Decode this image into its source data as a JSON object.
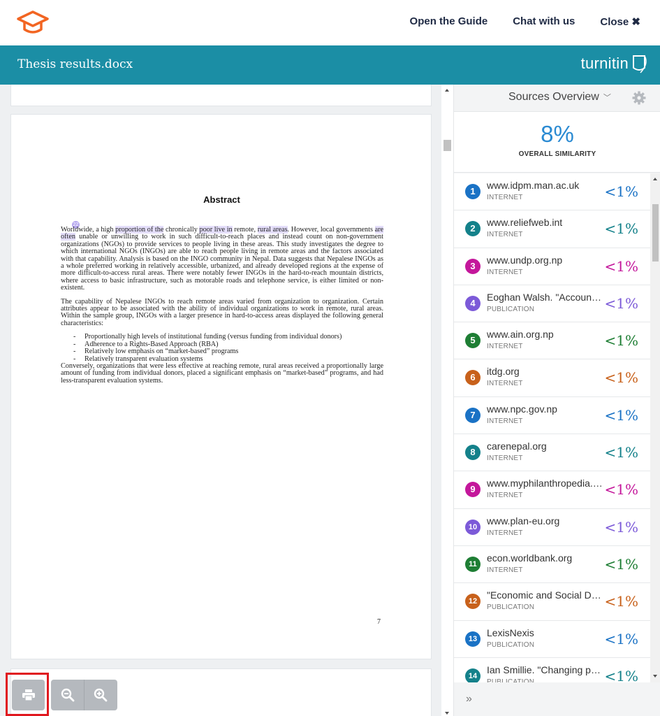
{
  "header": {
    "links": [
      "Open the Guide",
      "Chat with us",
      "Close"
    ]
  },
  "titlebar": {
    "document_title": "Thesis results.docx",
    "brand": "turnitin"
  },
  "document": {
    "heading": "Abstract",
    "match_marker": "22",
    "para1": [
      "Worldwide, a high ",
      "proportion of the",
      " chronically ",
      "poor live in",
      " remote, ",
      "rural areas",
      ". However, local governments ",
      "are often",
      " unable or unwilling to work in such difficult-to-reach places and instead count on non-government organizations (NGOs) to provide services to people living in these areas. This study investigates the degree to which international NGOs (INGOs) are able to reach people living in remote areas and the factors associated with that capability. Analysis is based on the INGO community in Nepal.  Data suggests that Nepalese INGOs as a whole preferred working in relatively accessible, urbanized, and already developed regions at the expense of more difficult-to-access rural areas. There were notably fewer INGOs in the hard-to-reach mountain districts, where access to basic infrastructure, such as motorable roads and telephone service, is either limited or non-existent."
    ],
    "para2": "The capability of Nepalese INGOs to reach remote areas varied from organization to organization. Certain attributes appear to be associated with the ability of individual organizations to work in remote, rural areas. Within the sample group, INGOs with a larger presence in hard-to-access areas displayed the following general characteristics:",
    "bullets": [
      "Proportionally high levels of institutional funding (versus funding from individual donors)",
      "Adherence to a Rights-Based Approach (RBA)",
      "Relatively low emphasis on “market-based” programs",
      "Relatively transparent evaluation systems"
    ],
    "para3": "Conversely, organizations that were less effective at reaching remote, rural areas received a proportionally large amount of funding from individual donors, placed a significant emphasis on “market-based” programs, and had less-transparent evaluation systems.",
    "page_number": "7"
  },
  "panel": {
    "title": "Sources Overview",
    "similarity_value": "8%",
    "similarity_label": "OVERALL SIMILARITY",
    "sources": [
      {
        "num": "1",
        "name": "www.idpm.man.ac.uk",
        "type": "INTERNET",
        "pct": "<1%",
        "color": "#1a72c5"
      },
      {
        "num": "2",
        "name": "www.reliefweb.int",
        "type": "INTERNET",
        "pct": "<1%",
        "color": "#14818a"
      },
      {
        "num": "3",
        "name": "www.undp.org.np",
        "type": "INTERNET",
        "pct": "<1%",
        "color": "#c4179b"
      },
      {
        "num": "4",
        "name": "Eoghan Walsh. \"Accountability...",
        "type": "PUBLICATION",
        "pct": "<1%",
        "color": "#7c5ad8"
      },
      {
        "num": "5",
        "name": "www.ain.org.np",
        "type": "INTERNET",
        "pct": "<1%",
        "color": "#1e7e34"
      },
      {
        "num": "6",
        "name": "itdg.org",
        "type": "INTERNET",
        "pct": "<1%",
        "color": "#c8611b"
      },
      {
        "num": "7",
        "name": "www.npc.gov.np",
        "type": "INTERNET",
        "pct": "<1%",
        "color": "#1a72c5"
      },
      {
        "num": "8",
        "name": "carenepal.org",
        "type": "INTERNET",
        "pct": "<1%",
        "color": "#14818a"
      },
      {
        "num": "9",
        "name": "www.myphilanthropedia.org",
        "type": "INTERNET",
        "pct": "<1%",
        "color": "#c4179b"
      },
      {
        "num": "10",
        "name": "www.plan-eu.org",
        "type": "INTERNET",
        "pct": "<1%",
        "color": "#7c5ad8"
      },
      {
        "num": "11",
        "name": "econ.worldbank.org",
        "type": "INTERNET",
        "pct": "<1%",
        "color": "#1e7e34"
      },
      {
        "num": "12",
        "name": "\"Economic and Social Development...",
        "type": "PUBLICATION",
        "pct": "<1%",
        "color": "#c8611b"
      },
      {
        "num": "13",
        "name": "LexisNexis",
        "type": "PUBLICATION",
        "pct": "<1%",
        "color": "#1a72c5"
      },
      {
        "num": "14",
        "name": "Ian Smillie. \"Changing partners...",
        "type": "PUBLICATION",
        "pct": "<1%",
        "color": "#14818a"
      }
    ],
    "expand_label": "»"
  },
  "colors": {
    "titlebar": "#1b8ea5",
    "logo": "#f26522",
    "similarity": "#2a8ad2",
    "highlight": "#e4defa"
  }
}
